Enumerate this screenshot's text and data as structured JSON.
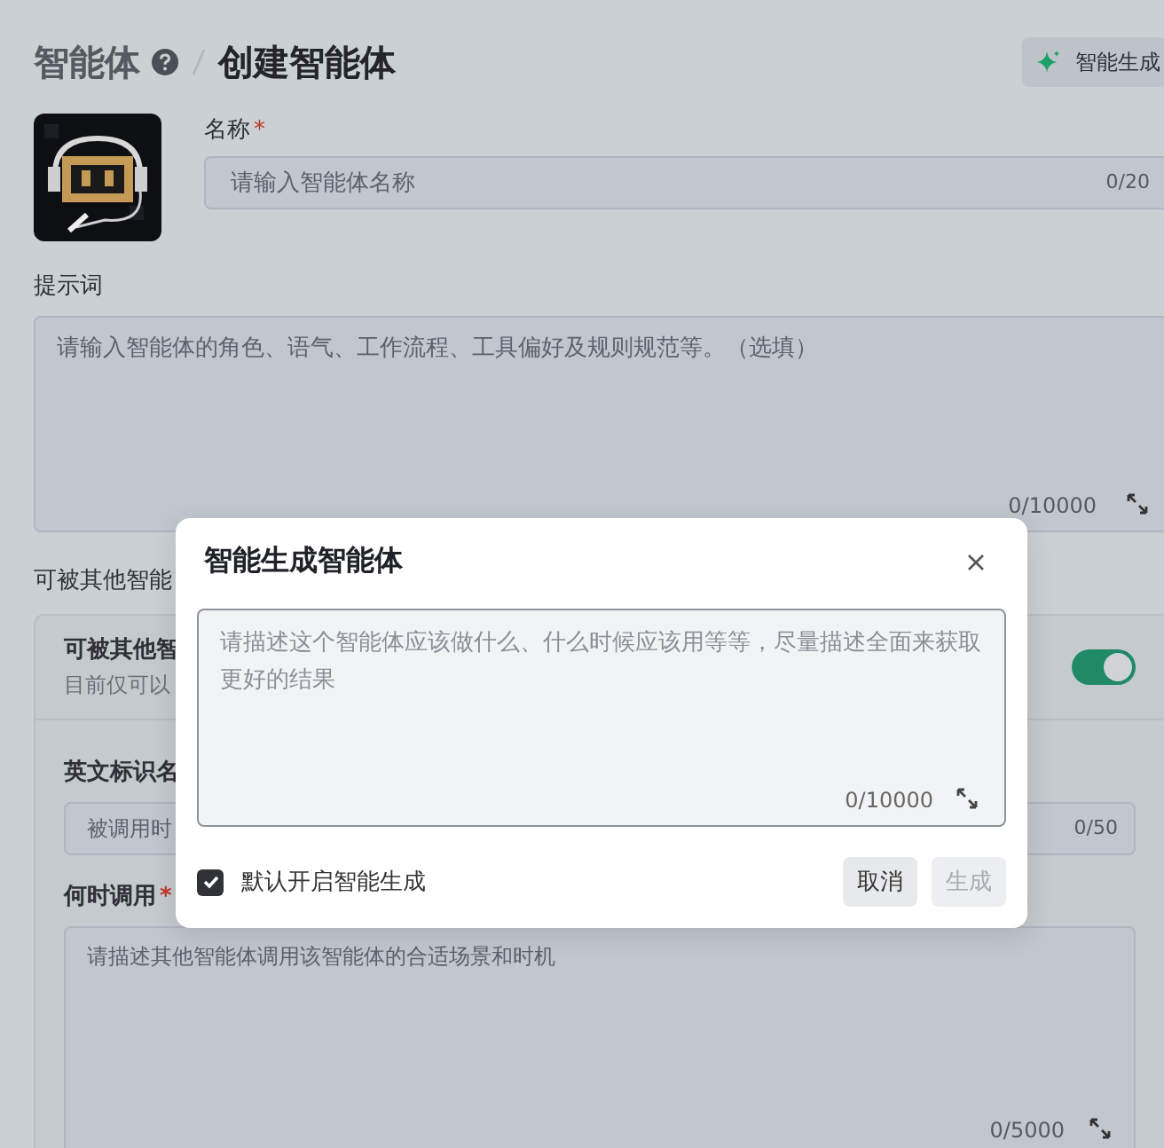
{
  "breadcrumb": [
    {
      "label": "智能体",
      "kind": "parent"
    },
    {
      "label": "创建智能体",
      "kind": "current"
    }
  ],
  "header_button": {
    "label": "智能生成"
  },
  "name_field": {
    "label": "名称",
    "required_mark": "*",
    "placeholder": "请输入智能体名称",
    "counter": "0/20"
  },
  "prompt_field": {
    "label": "提示词",
    "placeholder": "请输入智能体的角色、语气、工作流程、工具偏好及规则规范等。（选填）",
    "counter": "0/10000"
  },
  "callable_section": {
    "label": "可被其他智能",
    "card": {
      "title": "可被其他智",
      "subtitle": "目前仅可以",
      "on": true,
      "fields": [
        {
          "label": "英文标识名",
          "kind": "input",
          "placeholder": "被调用时",
          "counter": "0/50"
        },
        {
          "label": "何时调用",
          "kind": "textarea",
          "required_mark": "*",
          "placeholder": "请描述其他智能体调用该智能体的合适场景和时机",
          "counter": "0/5000"
        }
      ]
    }
  },
  "dialog": {
    "title": "智能生成智能体",
    "placeholder": "请描述这个智能体应该做什么、什么时候应该用等等，尽量描述全面来获取更好的结果",
    "counter": "0/10000",
    "checkbox": {
      "label": "默认开启智能生成",
      "checked": true
    },
    "buttons": [
      {
        "label": "取消",
        "disabled": false
      },
      {
        "label": "生成",
        "disabled": true
      }
    ]
  }
}
